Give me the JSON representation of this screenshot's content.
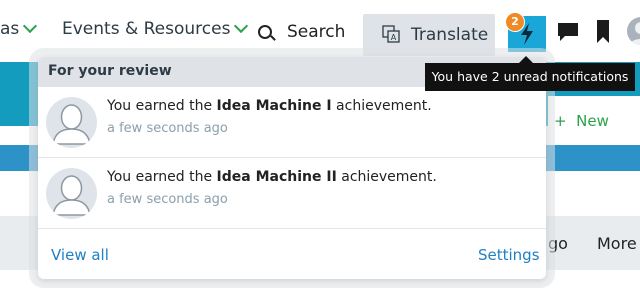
{
  "nav": {
    "ideas_label": "as",
    "events_label": "Events & Resources",
    "search_label": "Search",
    "translate_label": "Translate",
    "notification_count": "2"
  },
  "background": {
    "new_label": "New",
    "ago_label": "go",
    "more_label": "More"
  },
  "dropdown": {
    "title": "For your review",
    "notifications": [
      {
        "prefix": "You earned the ",
        "bold": "Idea Machine I",
        "suffix": " achievement.",
        "time": "a few seconds ago"
      },
      {
        "prefix": "You earned the ",
        "bold": "Idea Machine II",
        "suffix": " achievement.",
        "time": "a few seconds ago"
      }
    ],
    "view_all": "View all",
    "settings": "Settings"
  },
  "tooltip": "You have 2 unread notifications",
  "colors": {
    "teal": "#149cbf",
    "accent_green": "#2aa34a",
    "link_blue": "#1f80c4",
    "badge_orange": "#f08a24"
  }
}
